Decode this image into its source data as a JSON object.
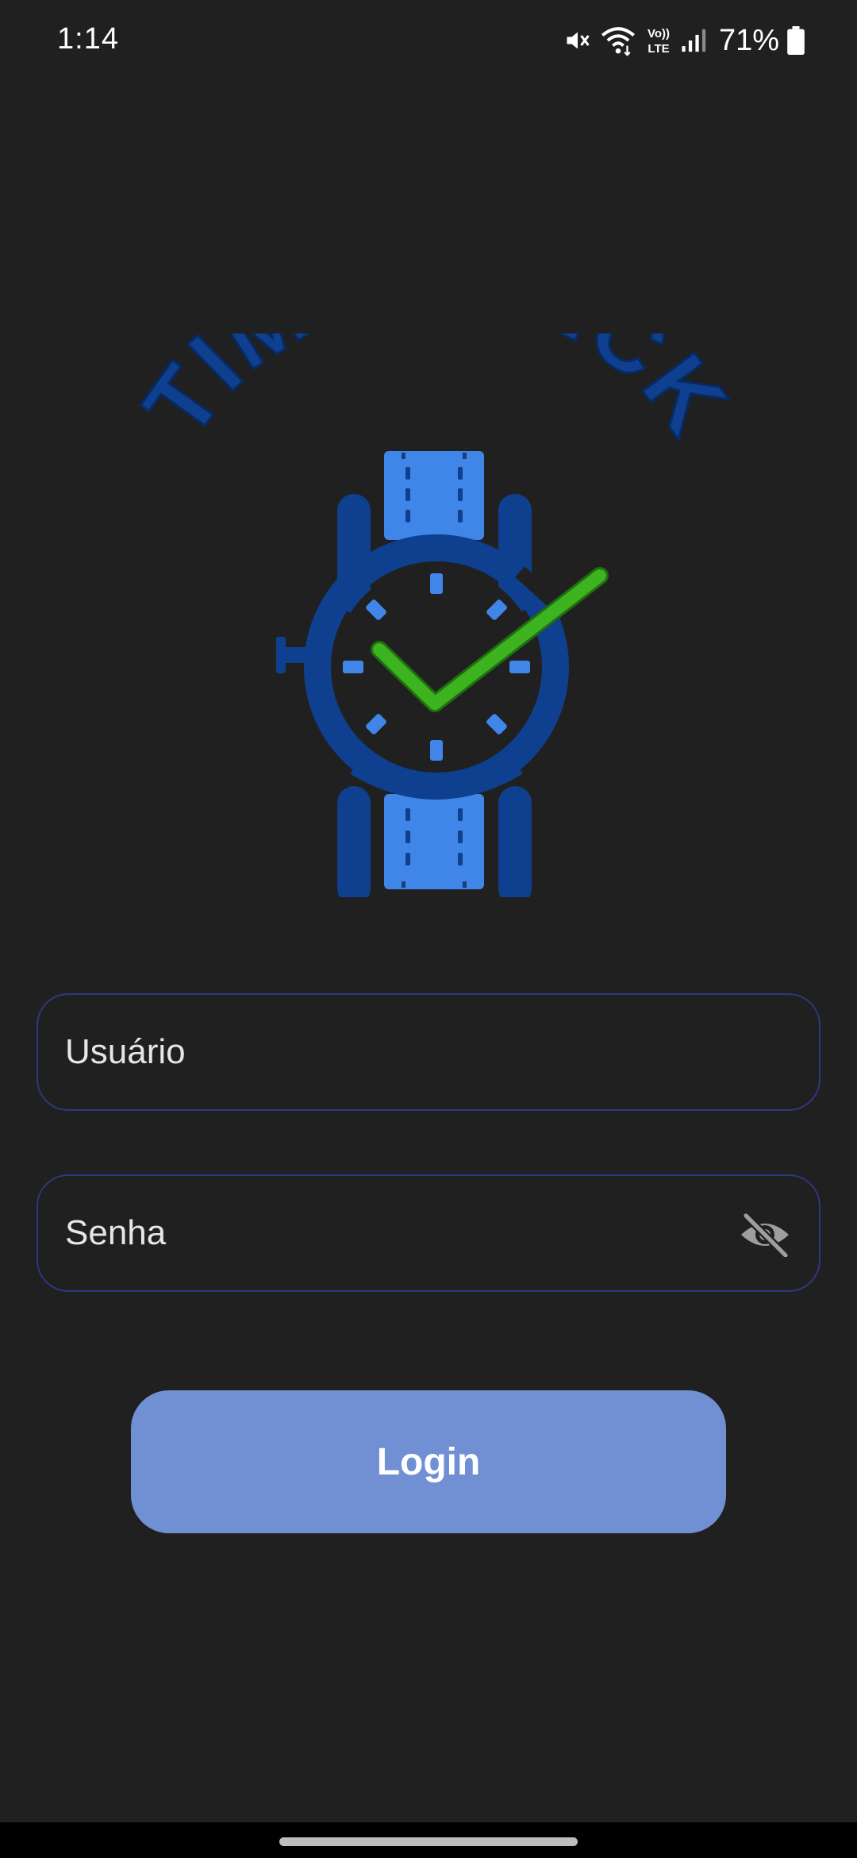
{
  "status_bar": {
    "time": "1:14",
    "battery_percent": "71%",
    "icons": [
      "mute-icon",
      "wifi-icon",
      "volte-icon",
      "signal-icon",
      "battery-icon"
    ],
    "volte_label_top": "Vo))",
    "volte_label_bottom": "LTE"
  },
  "logo": {
    "text": "TIMECHECK",
    "colors": {
      "text": "#0f3f8f",
      "watch_dark": "#0f3f8f",
      "watch_light": "#3f86e8",
      "check": "#3db31f"
    }
  },
  "form": {
    "username_placeholder": "Usuário",
    "password_placeholder": "Senha",
    "toggle_icon": "eye-off-icon"
  },
  "login_button": {
    "label": "Login"
  },
  "colors": {
    "background": "#202020",
    "field_border": "#2f3782",
    "button": "#7190d4"
  }
}
